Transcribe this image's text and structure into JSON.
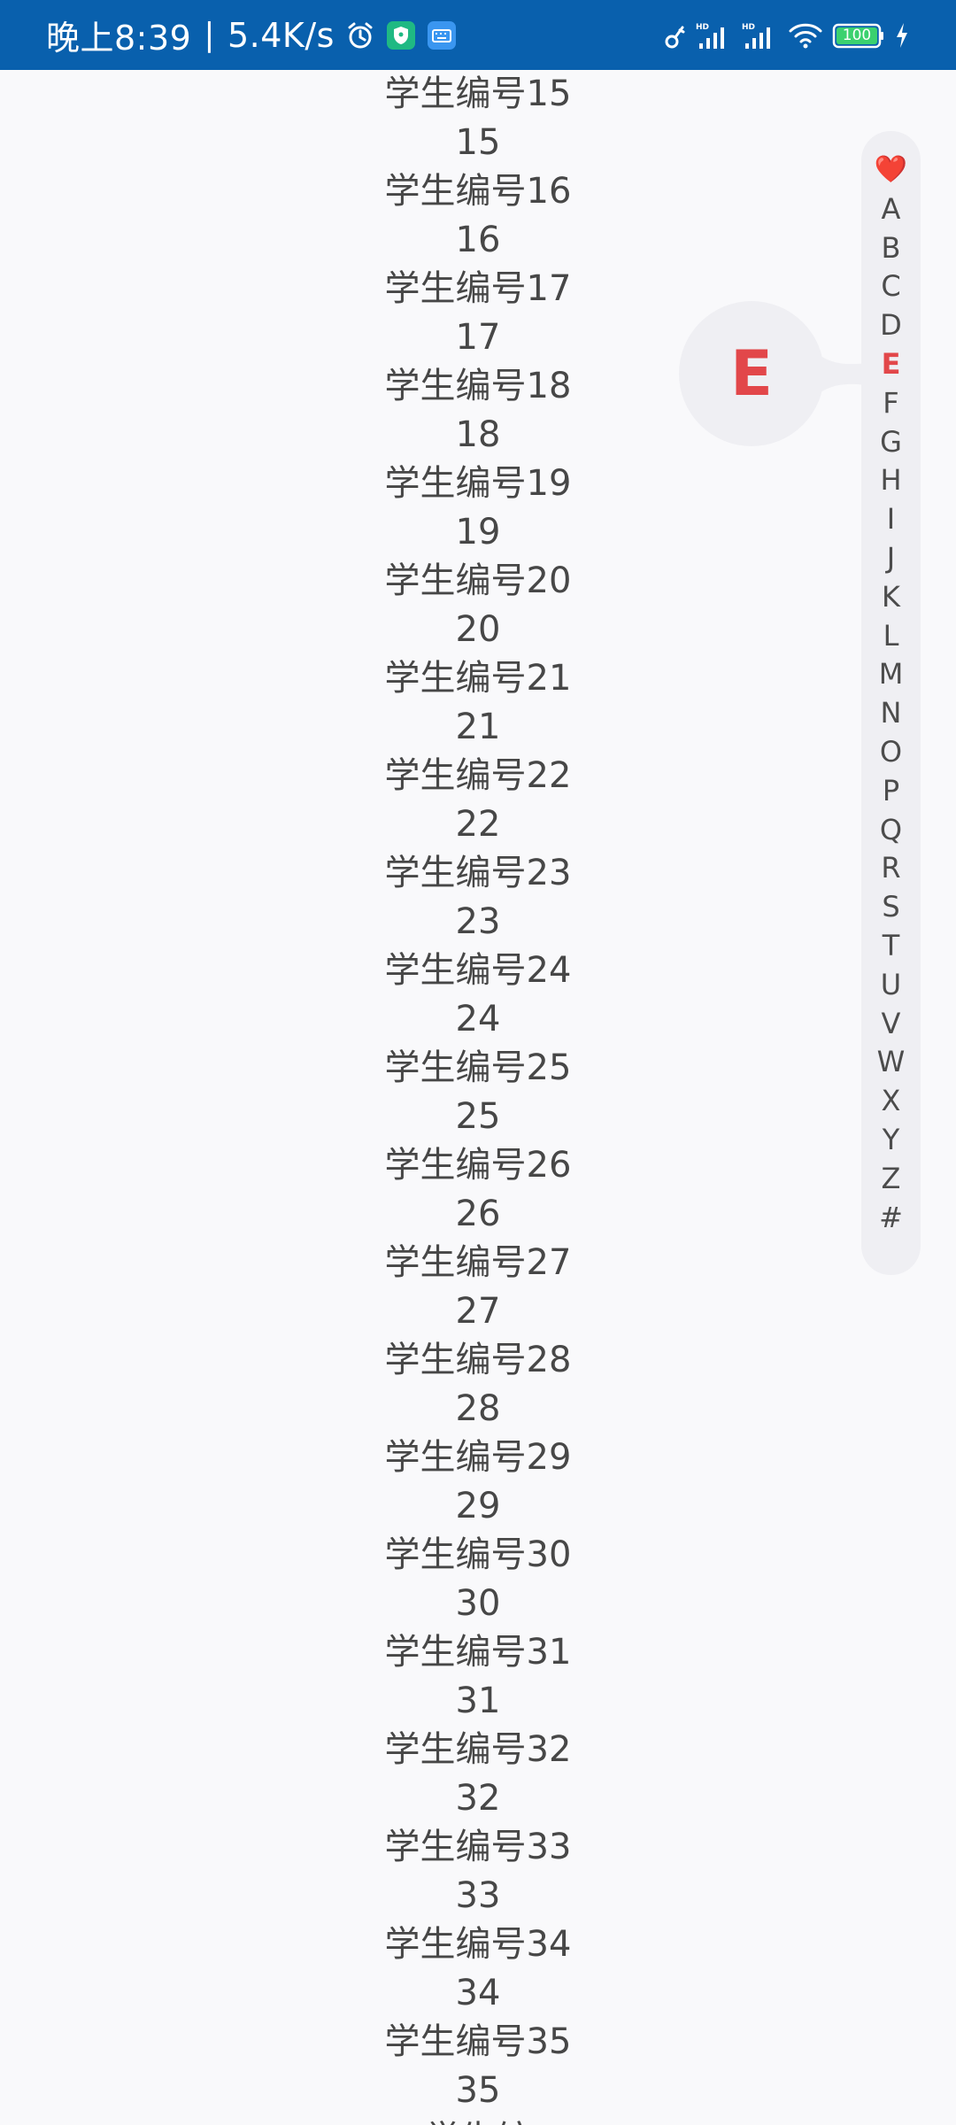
{
  "status_bar": {
    "time": "晚上8:39",
    "separator": "|",
    "net_speed": "5.4K/s",
    "battery": "100",
    "colors": {
      "background": "#0960ad",
      "foreground": "#ffffff"
    },
    "icons": [
      "alarm-icon",
      "shield-app-icon",
      "keyboard-app-icon",
      "key-icon",
      "hd-signal-icon",
      "hd-signal-icon-2",
      "wifi-icon",
      "battery-icon",
      "charging-icon"
    ]
  },
  "list": {
    "items": [
      {
        "name": "学生编号15",
        "num": "15"
      },
      {
        "name": "学生编号16",
        "num": "16"
      },
      {
        "name": "学生编号17",
        "num": "17"
      },
      {
        "name": "学生编号18",
        "num": "18"
      },
      {
        "name": "学生编号19",
        "num": "19"
      },
      {
        "name": "学生编号20",
        "num": "20"
      },
      {
        "name": "学生编号21",
        "num": "21"
      },
      {
        "name": "学生编号22",
        "num": "22"
      },
      {
        "name": "学生编号23",
        "num": "23"
      },
      {
        "name": "学生编号24",
        "num": "24"
      },
      {
        "name": "学生编号25",
        "num": "25"
      },
      {
        "name": "学生编号26",
        "num": "26"
      },
      {
        "name": "学生编号27",
        "num": "27"
      },
      {
        "name": "学生编号28",
        "num": "28"
      },
      {
        "name": "学生编号29",
        "num": "29"
      },
      {
        "name": "学生编号30",
        "num": "30"
      },
      {
        "name": "学生编号31",
        "num": "31"
      },
      {
        "name": "学生编号32",
        "num": "32"
      },
      {
        "name": "学生编号33",
        "num": "33"
      },
      {
        "name": "学生编号34",
        "num": "34"
      },
      {
        "name": "学生编号35",
        "num": "35"
      },
      {
        "name": "学生编",
        "num": ""
      }
    ]
  },
  "index_bar": {
    "letters": [
      "❤️",
      "A",
      "B",
      "C",
      "D",
      "E",
      "F",
      "G",
      "H",
      "I",
      "J",
      "K",
      "L",
      "M",
      "N",
      "O",
      "P",
      "Q",
      "R",
      "S",
      "T",
      "U",
      "V",
      "W",
      "X",
      "Y",
      "Z",
      "#"
    ],
    "selected": "E",
    "colors": {
      "active": "#e2474a",
      "background": "#efeff3"
    }
  },
  "bubble": {
    "letter": "E"
  }
}
